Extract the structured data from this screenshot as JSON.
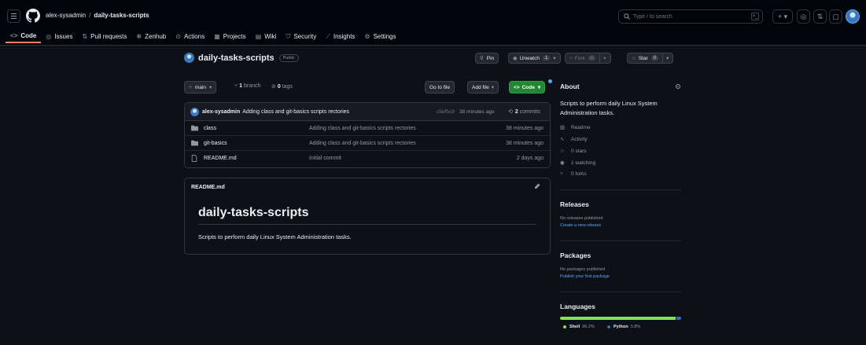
{
  "header": {
    "owner": "alex-sysadmin",
    "separator": "/",
    "repo": "daily-tasks-scripts",
    "search_placeholder": "Type / to search",
    "search_shortcut": ">_",
    "create_label": "+ ▾"
  },
  "tabs": [
    {
      "label": "Code",
      "icon": "code-icon"
    },
    {
      "label": "Issues",
      "icon": "issue-icon"
    },
    {
      "label": "Pull requests",
      "icon": "pull-request-icon"
    },
    {
      "label": "Zenhub",
      "icon": "zenhub-icon"
    },
    {
      "label": "Actions",
      "icon": "actions-icon"
    },
    {
      "label": "Projects",
      "icon": "projects-icon"
    },
    {
      "label": "Wiki",
      "icon": "wiki-icon"
    },
    {
      "label": "Security",
      "icon": "shield-icon"
    },
    {
      "label": "Insights",
      "icon": "graph-icon"
    },
    {
      "label": "Settings",
      "icon": "gear-icon"
    }
  ],
  "repo": {
    "name": "daily-tasks-scripts",
    "visibility": "Public",
    "pin_label": "Pin",
    "watch_label": "Unwatch",
    "watch_count": "1",
    "fork_label": "Fork",
    "fork_count": "0",
    "star_label": "Star",
    "star_count": "0"
  },
  "toolbar": {
    "branch": "main",
    "branches_count": "1",
    "branches_label": "branch",
    "tags_count": "0",
    "tags_label": "tags",
    "goto_file": "Go to file",
    "add_file": "Add file",
    "code": "Code"
  },
  "latest_commit": {
    "author": "alex-sysadmin",
    "message": "Adding class and git-basics scripts rectories",
    "sha": "c5ef5c9",
    "time": "38 minutes ago",
    "commits_count": "2",
    "commits_label": "commits"
  },
  "files": [
    {
      "type": "folder",
      "name": "class",
      "message": "Adding class and git-basics scripts rectories",
      "date": "38 minutes ago"
    },
    {
      "type": "folder",
      "name": "git-basics",
      "message": "Adding class and git-basics scripts rectories",
      "date": "38 minutes ago"
    },
    {
      "type": "file",
      "name": "README.md",
      "message": "Initial commit",
      "date": "2 days ago"
    }
  ],
  "readme": {
    "filename": "README.md",
    "heading": "daily-tasks-scripts",
    "body": "Scripts to perform daily Linux System Administration tasks."
  },
  "about": {
    "title": "About",
    "description": "Scripts to perform daily Linux System Administration tasks.",
    "links": [
      {
        "icon": "book-icon",
        "label": "Readme"
      },
      {
        "icon": "pulse-icon",
        "label": "Activity"
      },
      {
        "icon": "star-icon",
        "label": "0 stars"
      },
      {
        "icon": "eye-icon",
        "label": "1 watching"
      },
      {
        "icon": "fork-icon",
        "label": "0 forks"
      }
    ]
  },
  "releases": {
    "title": "Releases",
    "empty": "No releases published",
    "create": "Create a new release"
  },
  "packages": {
    "title": "Packages",
    "empty": "No packages published",
    "publish": "Publish your first package"
  },
  "languages": {
    "title": "Languages",
    "items": [
      {
        "name": "Shell",
        "percent": "96.2%",
        "value": 96.2,
        "color": "#89e051"
      },
      {
        "name": "Python",
        "percent": "3.8%",
        "value": 3.8,
        "color": "#3572A5"
      }
    ]
  }
}
